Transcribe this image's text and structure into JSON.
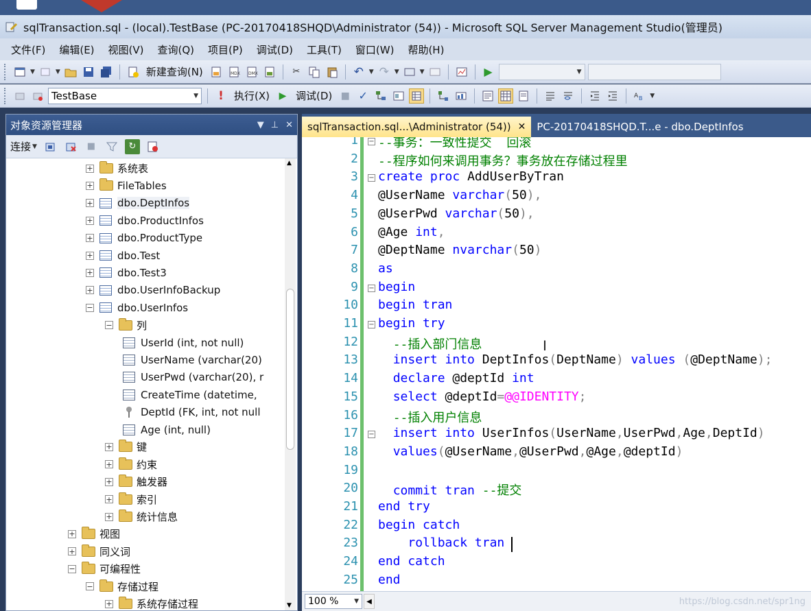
{
  "window": {
    "title": "sqlTransaction.sql - (local).TestBase (PC-20170418SHQD\\Administrator (54)) - Microsoft SQL Server Management Studio(管理员)"
  },
  "menu": [
    "文件(F)",
    "编辑(E)",
    "视图(V)",
    "查询(Q)",
    "项目(P)",
    "调试(D)",
    "工具(T)",
    "窗口(W)",
    "帮助(H)"
  ],
  "toolbar1": {
    "new_query": "新建查询(N)"
  },
  "toolbar2": {
    "database": "TestBase",
    "execute": "执行(X)",
    "debug": "调试(D)"
  },
  "object_explorer": {
    "title": "对象资源管理器",
    "connect": "连接",
    "tree": [
      {
        "label": "系统表",
        "kind": "folder",
        "level": 2,
        "expander": "+"
      },
      {
        "label": "FileTables",
        "kind": "folder",
        "level": 2,
        "expander": "+"
      },
      {
        "label": "dbo.DeptInfos",
        "kind": "table",
        "level": 2,
        "expander": "+"
      },
      {
        "label": "dbo.ProductInfos",
        "kind": "table",
        "level": 2,
        "expander": "+"
      },
      {
        "label": "dbo.ProductType",
        "kind": "table",
        "level": 2,
        "expander": "+"
      },
      {
        "label": "dbo.Test",
        "kind": "table",
        "level": 2,
        "expander": "+"
      },
      {
        "label": "dbo.Test3",
        "kind": "table",
        "level": 2,
        "expander": "+"
      },
      {
        "label": "dbo.UserInfoBackup",
        "kind": "table",
        "level": 2,
        "expander": "+"
      },
      {
        "label": "dbo.UserInfos",
        "kind": "table",
        "level": 2,
        "expander": "−"
      },
      {
        "label": "列",
        "kind": "folder",
        "level": 3,
        "expander": "−"
      },
      {
        "label": "UserId (int, not null)",
        "kind": "column",
        "level": 4,
        "expander": ""
      },
      {
        "label": "UserName (varchar(20)",
        "kind": "column",
        "level": 4,
        "expander": ""
      },
      {
        "label": "UserPwd (varchar(20), r",
        "kind": "column",
        "level": 4,
        "expander": ""
      },
      {
        "label": "CreateTime (datetime,",
        "kind": "column",
        "level": 4,
        "expander": ""
      },
      {
        "label": "DeptId (FK, int, not null",
        "kind": "key",
        "level": 4,
        "expander": ""
      },
      {
        "label": "Age (int, null)",
        "kind": "column",
        "level": 4,
        "expander": ""
      },
      {
        "label": "键",
        "kind": "folder",
        "level": 3,
        "expander": "+"
      },
      {
        "label": "约束",
        "kind": "folder",
        "level": 3,
        "expander": "+"
      },
      {
        "label": "触发器",
        "kind": "folder",
        "level": 3,
        "expander": "+"
      },
      {
        "label": "索引",
        "kind": "folder",
        "level": 3,
        "expander": "+"
      },
      {
        "label": "统计信息",
        "kind": "folder",
        "level": 3,
        "expander": "+"
      },
      {
        "label": "视图",
        "kind": "folder",
        "level": 1,
        "expander": "+"
      },
      {
        "label": "同义词",
        "kind": "folder",
        "level": 1,
        "expander": "+"
      },
      {
        "label": "可编程性",
        "kind": "folder",
        "level": 1,
        "expander": "−"
      },
      {
        "label": "存储过程",
        "kind": "folder",
        "level": 2,
        "expander": "−"
      },
      {
        "label": "系统存储过程",
        "kind": "folder",
        "level": 3,
        "expander": "+"
      }
    ]
  },
  "tabs": [
    {
      "label": "sqlTransaction.sql...\\Administrator (54))",
      "active": true,
      "close": "✕"
    },
    {
      "label": "PC-20170418SHQD.T...e - dbo.DeptInfos",
      "active": false,
      "close": ""
    }
  ],
  "editor": {
    "lines": [
      {
        "n": "1",
        "fold": "−",
        "html": "<span class='cm'>--事务：一致性提交  回滚</span>"
      },
      {
        "n": "2",
        "fold": "",
        "html": "<span class='cm'>--程序如何来调用事务？事务放在存储过程里</span>"
      },
      {
        "n": "3",
        "fold": "−",
        "html": "<span class='kw'>create proc</span> <span class='var'>AddUserByTran</span>"
      },
      {
        "n": "4",
        "fold": "",
        "html": "<span class='var'>@UserName</span> <span class='kw'>varchar</span><span class='gry'>(</span>50<span class='gry'>),</span>"
      },
      {
        "n": "5",
        "fold": "",
        "html": "<span class='var'>@UserPwd</span> <span class='kw'>varchar</span><span class='gry'>(</span>50<span class='gry'>),</span>"
      },
      {
        "n": "6",
        "fold": "",
        "html": "<span class='var'>@Age</span> <span class='kw'>int</span><span class='gry'>,</span>"
      },
      {
        "n": "7",
        "fold": "",
        "html": "<span class='var'>@DeptName</span> <span class='kw'>nvarchar</span><span class='gry'>(</span>50<span class='gry'>)</span>"
      },
      {
        "n": "8",
        "fold": "",
        "html": "<span class='kw'>as</span>"
      },
      {
        "n": "9",
        "fold": "−",
        "html": "<span class='kw'>begin</span>"
      },
      {
        "n": "10",
        "fold": "",
        "html": "<span class='kw'>begin tran</span>"
      },
      {
        "n": "11",
        "fold": "−",
        "html": "<span class='kw'>begin try</span>"
      },
      {
        "n": "12",
        "fold": "",
        "html": "  <span class='cm'>--插入部门信息</span>"
      },
      {
        "n": "13",
        "fold": "",
        "html": "  <span class='kw'>insert into</span> DeptInfos<span class='gry'>(</span>DeptName<span class='gry'>)</span> <span class='kw'>values</span> <span class='gry'>(</span>@DeptName<span class='gry'>);</span>"
      },
      {
        "n": "14",
        "fold": "",
        "html": "  <span class='kw'>declare</span> @deptId <span class='kw'>int</span>"
      },
      {
        "n": "15",
        "fold": "",
        "html": "  <span class='kw'>select</span> @deptId<span class='gry'>=</span><span class='pink'>@@IDENTITY</span><span class='gry'>;</span>"
      },
      {
        "n": "16",
        "fold": "",
        "html": "  <span class='cm'>--插入用户信息</span>"
      },
      {
        "n": "17",
        "fold": "−",
        "html": "  <span class='kw'>insert into</span> UserInfos<span class='gry'>(</span>UserName<span class='gry'>,</span>UserPwd<span class='gry'>,</span>Age<span class='gry'>,</span>DeptId<span class='gry'>)</span>"
      },
      {
        "n": "18",
        "fold": "",
        "html": "  <span class='kw'>values</span><span class='gry'>(</span>@UserName<span class='gry'>,</span>@UserPwd<span class='gry'>,</span>@Age<span class='gry'>,</span>@deptId<span class='gry'>)</span>"
      },
      {
        "n": "19",
        "fold": "",
        "html": ""
      },
      {
        "n": "20",
        "fold": "",
        "html": "  <span class='kw'>commit tran</span> <span class='cm'>--提交</span>"
      },
      {
        "n": "21",
        "fold": "",
        "html": "<span class='kw'>end try</span>"
      },
      {
        "n": "22",
        "fold": "",
        "html": "<span class='kw'>begin catch</span>"
      },
      {
        "n": "23",
        "fold": "",
        "html": "    <span class='kw'>rollback tran</span>"
      },
      {
        "n": "24",
        "fold": "",
        "html": "<span class='kw'>end catch</span>"
      },
      {
        "n": "25",
        "fold": "",
        "html": "<span class='kw'>end</span>"
      }
    ]
  },
  "status": {
    "zoom": "100 %"
  },
  "watermark": "https://blog.csdn.net/spr1ng"
}
